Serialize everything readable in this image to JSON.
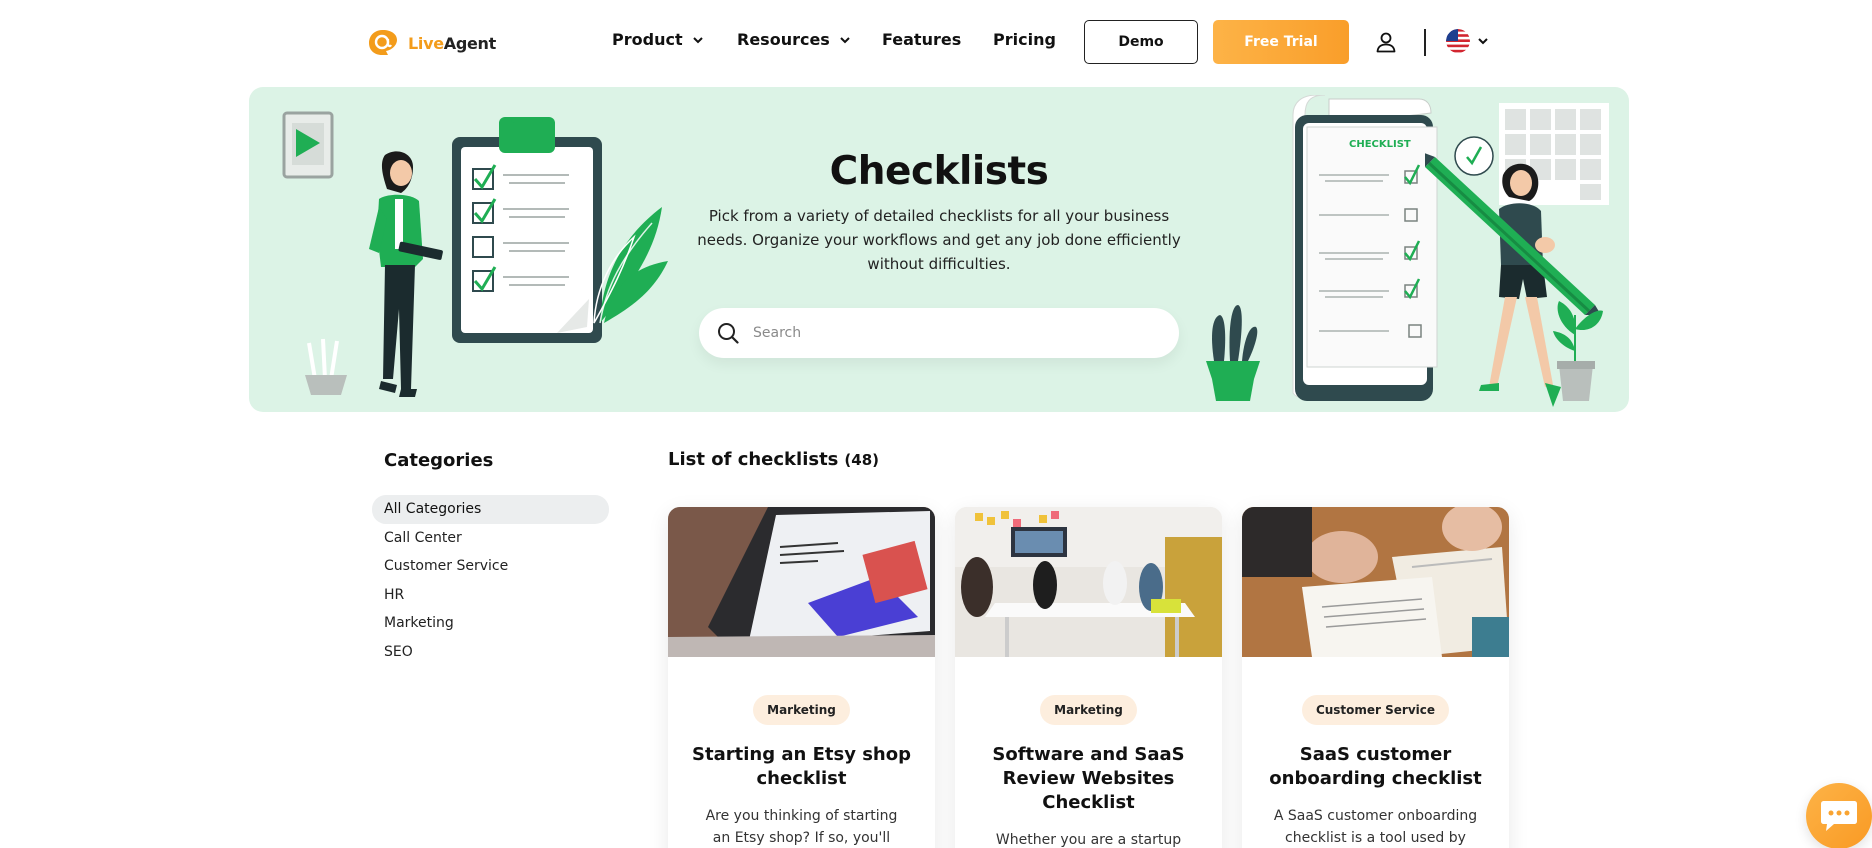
{
  "brand": {
    "name_part1": "Live",
    "name_part2": "Agent"
  },
  "nav": {
    "product": "Product",
    "resources": "Resources",
    "features": "Features",
    "pricing": "Pricing",
    "demo": "Demo",
    "free_trial": "Free Trial"
  },
  "hero": {
    "title": "Checklists",
    "description": "Pick from a variety of detailed checklists for all your business needs. Organize your workflows and get any job done efficiently without difficulties.",
    "search_placeholder": "Search",
    "illustration_label": "CHECKLIST"
  },
  "sidebar": {
    "title": "Categories",
    "items": [
      {
        "label": "All Categories",
        "active": true
      },
      {
        "label": "Call Center",
        "active": false
      },
      {
        "label": "Customer Service",
        "active": false
      },
      {
        "label": "HR",
        "active": false
      },
      {
        "label": "Marketing",
        "active": false
      },
      {
        "label": "SEO",
        "active": false
      }
    ]
  },
  "list": {
    "title": "List of checklists",
    "count": "(48)",
    "cards": [
      {
        "tag": "Marketing",
        "title": "Starting an Etsy shop checklist",
        "desc": "Are you thinking of starting an Etsy shop? If so, you'll need"
      },
      {
        "tag": "Marketing",
        "title": "Software and SaaS Review Websites Checklist",
        "desc": "Whether you are a startup"
      },
      {
        "tag": "Customer Service",
        "title": "SaaS customer onboarding checklist",
        "desc": "A SaaS customer onboarding checklist is a tool used by"
      }
    ]
  },
  "colors": {
    "accent_orange": "#f9a431",
    "hero_bg": "#dcf3e6",
    "illustration_green": "#1fae54",
    "tag_bg": "#fdeede"
  }
}
